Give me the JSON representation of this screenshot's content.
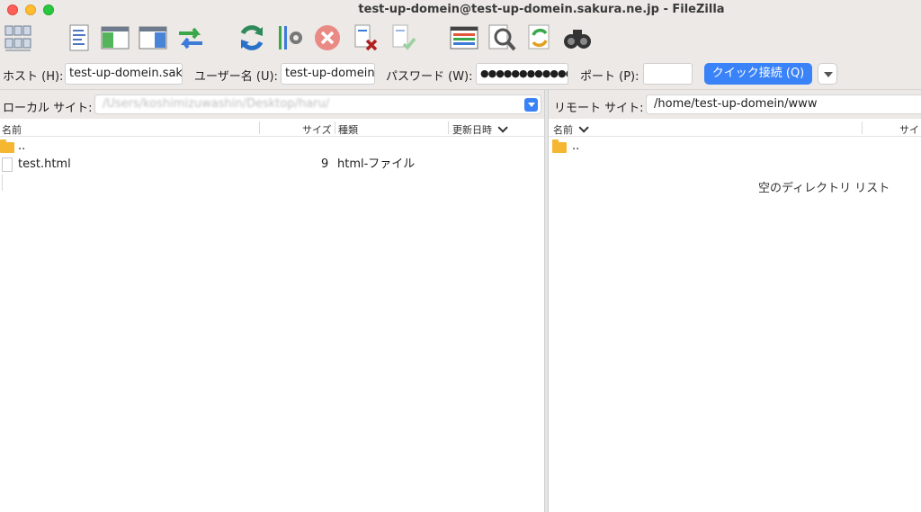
{
  "window": {
    "title": "test-up-domein@test-up-domein.sakura.ne.jp - FileZilla"
  },
  "toolbar": {
    "icons": [
      "site-manager-icon",
      "message-log-icon",
      "local-tree-icon",
      "remote-tree-icon",
      "transfer-queue-icon",
      "refresh-icon",
      "process-queue-icon",
      "cancel-icon",
      "disconnect-icon",
      "reconnect-icon",
      "directory-listing-filters-icon",
      "compare-icon",
      "sync-browse-icon",
      "search-icon"
    ]
  },
  "quickconnect": {
    "host_label": "ホスト (H):",
    "host_value": "test-up-domein.sak",
    "user_label": "ユーザー名 (U):",
    "user_value": "test-up-domein",
    "pass_label": "パスワード (W):",
    "pass_value": "●●●●●●●●●●●●",
    "port_label": "ポート (P):",
    "port_value": "",
    "connect_label": "クイック接続 (Q)"
  },
  "local": {
    "site_label": "ローカル サイト:",
    "path": "/Users/koshimizuwashin/Desktop/haru/",
    "columns": {
      "name": "名前",
      "size": "サイズ",
      "type": "種類",
      "modified": "更新日時"
    },
    "rows": [
      {
        "name": "..",
        "size": "",
        "type": "",
        "kind": "folder"
      },
      {
        "name": "test.html",
        "size": "9",
        "type": "html-ファイル",
        "kind": "file"
      }
    ]
  },
  "remote": {
    "site_label": "リモート サイト:",
    "path": "/home/test-up-domein/www",
    "columns": {
      "name": "名前",
      "size": "サイ"
    },
    "rows": [
      {
        "name": "..",
        "kind": "folder"
      }
    ],
    "empty_message": "空のディレクトリ リスト"
  },
  "colors": {
    "accent": "#3a82f7",
    "folder": "#f5b731",
    "chrome": "#ece9e6"
  }
}
